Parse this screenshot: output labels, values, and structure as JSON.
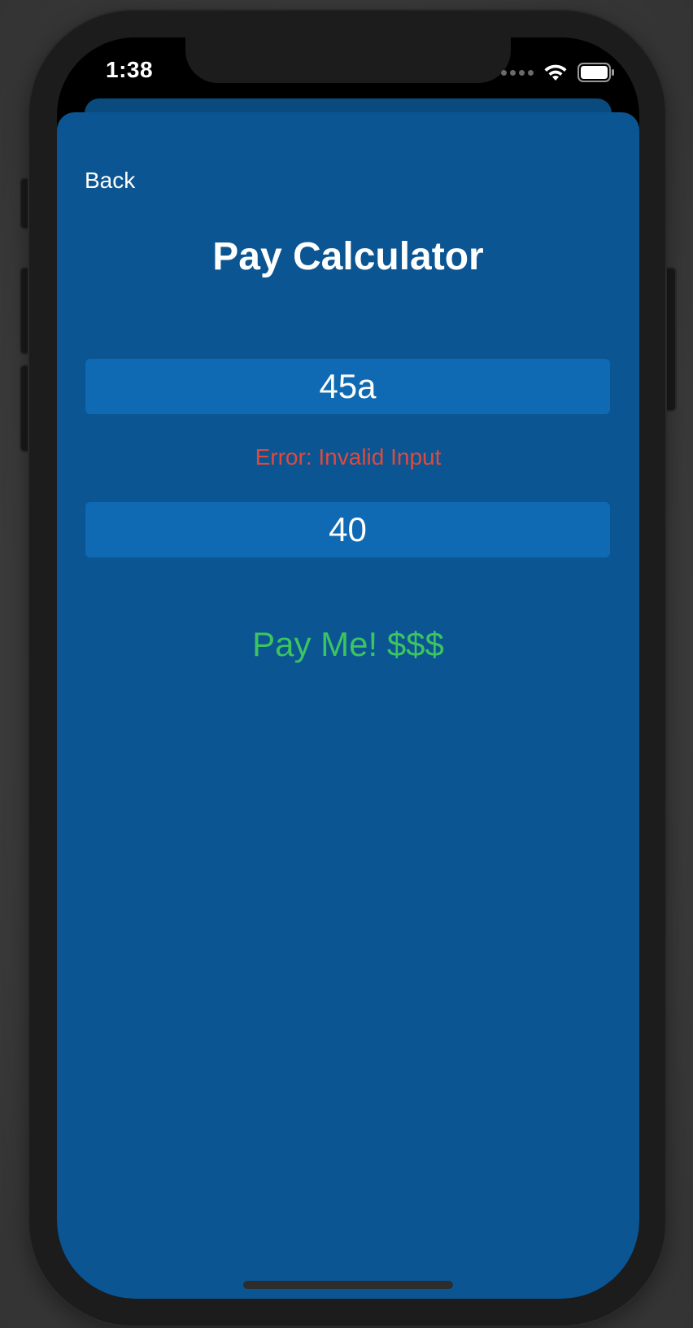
{
  "status_bar": {
    "time": "1:38",
    "signal_icon": "cellular-dots-icon",
    "wifi_icon": "wifi-icon",
    "battery_icon": "battery-icon"
  },
  "nav": {
    "back_label": "Back"
  },
  "main": {
    "title": "Pay Calculator",
    "hours_value": "45a",
    "error_message": "Error: Invalid Input",
    "rate_value": "40",
    "pay_button_label": "Pay Me! $$$"
  },
  "colors": {
    "sheet_background": "#0b5592",
    "field_background": "#0f6ab3",
    "error": "#e04a3c",
    "pay_button": "#3cc460"
  }
}
